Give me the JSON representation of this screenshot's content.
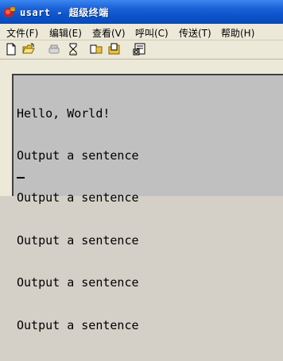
{
  "window": {
    "title": "usart - 超级终端",
    "colors": {
      "titlebar": "#0b52c8",
      "menubar": "#ece9d8",
      "terminal_bg": "#c0c0c0"
    }
  },
  "menu": {
    "items": [
      {
        "label": "文件(F)"
      },
      {
        "label": "编辑(E)"
      },
      {
        "label": "查看(V)"
      },
      {
        "label": "呼叫(C)"
      },
      {
        "label": "传送(T)"
      },
      {
        "label": "帮助(H)"
      }
    ]
  },
  "toolbar": {
    "icons": [
      "new-icon",
      "open-icon",
      "disconnect-icon",
      "connect-icon",
      "send-icon",
      "receive-icon",
      "properties-icon"
    ]
  },
  "terminal": {
    "lines": [
      "Hello, World!",
      "Output a sentence",
      "Output a sentence",
      "Output a sentence",
      "Output a sentence",
      "Output a sentence"
    ]
  }
}
